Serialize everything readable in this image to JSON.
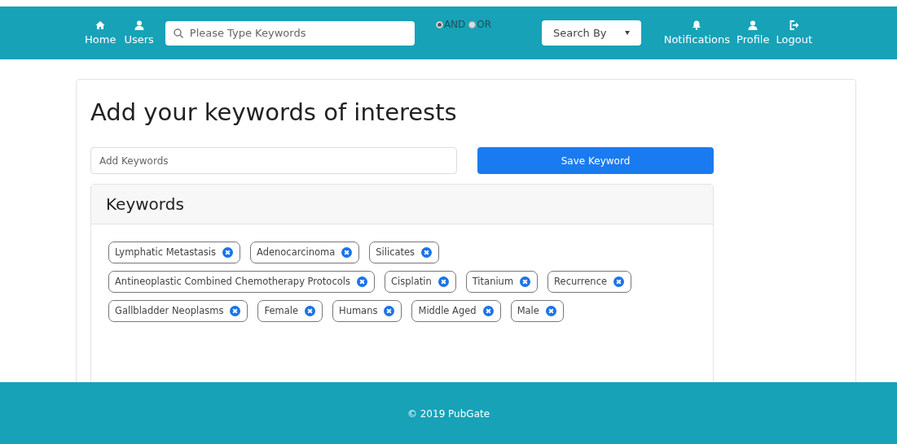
{
  "nav": {
    "left": [
      {
        "label": "Home",
        "kind": "home"
      },
      {
        "label": "Users",
        "kind": "user"
      }
    ],
    "search": {
      "placeholder": "Please Type Keywords"
    },
    "modes": [
      {
        "label": "AND",
        "selected": true
      },
      {
        "label": "OR",
        "selected": false
      }
    ],
    "search_by": {
      "value": "Search By"
    },
    "right": [
      {
        "label": "Notifications",
        "kind": "bell"
      },
      {
        "label": "Profile",
        "kind": "user"
      },
      {
        "label": "Logout",
        "kind": "logout"
      }
    ]
  },
  "title": "Add your keywords of interests",
  "add_field": {
    "placeholder": "Add Keywords"
  },
  "save_button": "Save Keyword",
  "keywords": {
    "title": "Keywords",
    "rows": [
      [
        "Lymphatic Metastasis",
        "Adenocarcinoma",
        "Silicates"
      ],
      [
        "Antineoplastic Combined Chemotherapy Protocols",
        "Cisplatin",
        "Titanium",
        "Recurrence"
      ],
      [
        "Gallbladder Neoplasms",
        "Female",
        "Humans",
        "Middle Aged",
        "Male"
      ]
    ]
  },
  "footer": "© 2019 PubGate"
}
